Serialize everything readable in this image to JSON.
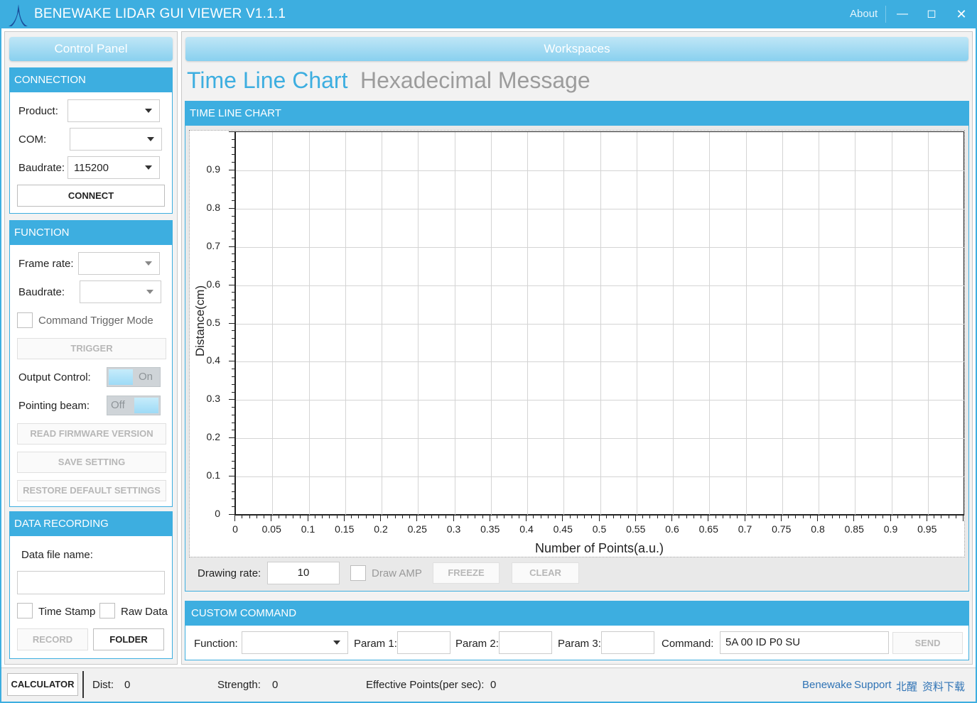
{
  "window": {
    "title": "BENEWAKE LIDAR GUI VIEWER V1.1.1",
    "about": "About",
    "minimize_glyph": "—",
    "maximize_glyph": "◻",
    "close_glyph": "✕"
  },
  "control_panel": {
    "title": "Control Panel",
    "connection": {
      "header": "CONNECTION",
      "product_label": "Product:",
      "product_value": "",
      "com_label": "COM:",
      "com_value": "",
      "baudrate_label": "Baudrate:",
      "baudrate_value": "115200",
      "connect_button": "CONNECT"
    },
    "function": {
      "header": "FUNCTION",
      "frame_rate_label": "Frame rate:",
      "frame_rate_value": "",
      "baudrate_label": "Baudrate:",
      "baudrate_value": "",
      "command_trigger_label": "Command Trigger Mode",
      "trigger_button": "TRIGGER",
      "output_control_label": "Output Control:",
      "output_control_state": "On",
      "pointing_beam_label": "Pointing beam:",
      "pointing_beam_state": "Off",
      "read_firmware_button": "READ FIRMWARE VERSION",
      "save_setting_button": "SAVE SETTING",
      "restore_default_button": "RESTORE DEFAULT SETTINGS"
    },
    "data_recording": {
      "header": "DATA RECORDING",
      "file_name_label": "Data file name:",
      "file_name_value": "",
      "time_stamp_label": "Time Stamp",
      "raw_data_label": "Raw Data",
      "record_button": "RECORD",
      "folder_button": "FOLDER"
    }
  },
  "workspaces": {
    "title": "Workspaces",
    "tabs": [
      {
        "label": "Time Line Chart",
        "active": true
      },
      {
        "label": "Hexadecimal Message",
        "active": false
      }
    ],
    "timeline": {
      "header": "TIME LINE CHART",
      "drawing_rate_label": "Drawing rate:",
      "drawing_rate_value": "10",
      "draw_amp_label": "Draw AMP",
      "freeze_button": "FREEZE",
      "clear_button": "CLEAR"
    },
    "custom_command": {
      "header": "CUSTOM COMMAND",
      "function_label": "Function:",
      "function_value": "",
      "param1_label": "Param 1:",
      "param2_label": "Param 2:",
      "param3_label": "Param 3:",
      "command_label": "Command:",
      "command_value": "5A 00 ID P0 SU",
      "send_button": "SEND"
    }
  },
  "chart_data": {
    "type": "line",
    "title": "",
    "xlabel": "Number of Points(a.u.)",
    "ylabel": "Distance(cm)",
    "xlim": [
      0,
      1
    ],
    "ylim": [
      0,
      1
    ],
    "x_ticks": [
      "0",
      "0.05",
      "0.1",
      "0.15",
      "0.2",
      "0.25",
      "0.3",
      "0.35",
      "0.4",
      "0.45",
      "0.5",
      "0.55",
      "0.6",
      "0.65",
      "0.7",
      "0.75",
      "0.8",
      "0.85",
      "0.9",
      "0.95"
    ],
    "y_ticks": [
      "0",
      "0.1",
      "0.2",
      "0.3",
      "0.4",
      "0.5",
      "0.6",
      "0.7",
      "0.8",
      "0.9"
    ],
    "series": [],
    "grid": true
  },
  "status": {
    "calculator_button": "CALCULATOR",
    "dist_label": "Dist:",
    "dist_value": "0",
    "strength_label": "Strength:",
    "strength_value": "0",
    "effective_points_label": "Effective Points(per sec):",
    "effective_points_value": "0",
    "support_links": [
      "Benewake",
      "Support",
      "北醒",
      "资料下载"
    ]
  },
  "colors": {
    "accent": "#3daee0",
    "ribbon": "#9fd9f2",
    "support_link": "#2f73b5"
  }
}
